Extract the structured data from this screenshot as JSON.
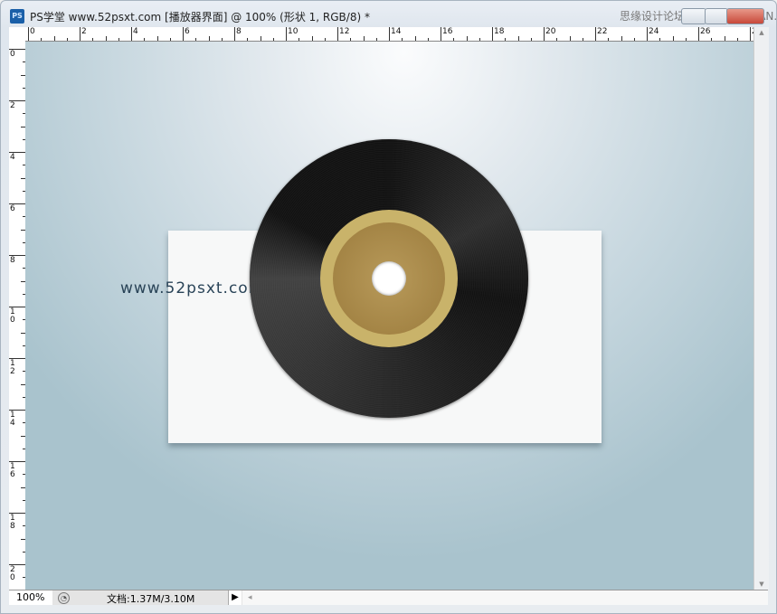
{
  "window": {
    "app_icon": "PS",
    "title": "PS学堂 www.52psxt.com [播放器界面] @ 100% (形状 1, RGB/8) *",
    "overlay_watermark": "思缘设计论坛 www.MISSYUAN.COM"
  },
  "rulers": {
    "horizontal": [
      "0",
      "2",
      "4",
      "6",
      "8",
      "10",
      "12",
      "14",
      "16",
      "18",
      "20",
      "22",
      "24",
      "26",
      "28"
    ],
    "vertical": [
      "0",
      "2",
      "4",
      "6",
      "8",
      "10",
      "12",
      "14",
      "16",
      "18",
      "20"
    ]
  },
  "canvas": {
    "watermark": "www.52psxt.com",
    "colors": {
      "background": "#c5d6de",
      "card": "#f7f8f8",
      "vinyl": "#111111",
      "label_ring": "#c9b36a",
      "label": "#a88a4a"
    }
  },
  "status": {
    "zoom": "100%",
    "doc_info": "文档:1.37M/3.10M",
    "play": "▶",
    "scroll_left": "◂"
  },
  "scrollbar": {
    "up": "▲",
    "down": "▼"
  }
}
